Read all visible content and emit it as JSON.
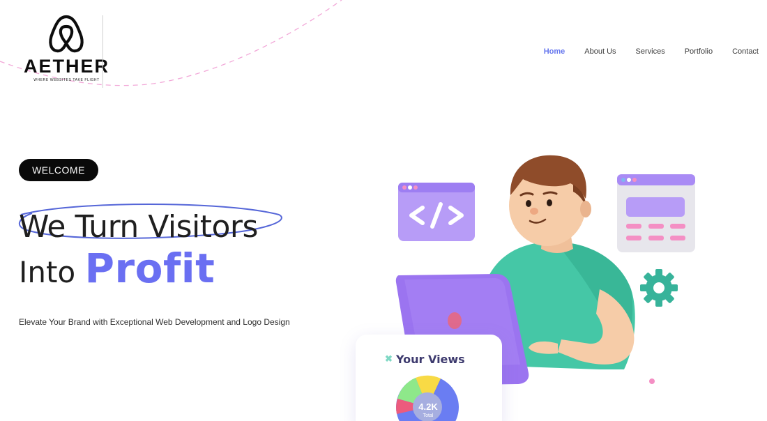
{
  "brand": {
    "name": "AETHER",
    "tagline": "WHERE WEBSITES TAKE FLIGHT"
  },
  "nav": {
    "items": [
      {
        "label": "Home",
        "active": true
      },
      {
        "label": "About Us",
        "active": false
      },
      {
        "label": "Services",
        "active": false
      },
      {
        "label": "Portfolio",
        "active": false
      },
      {
        "label": "Contact",
        "active": false
      }
    ]
  },
  "hero": {
    "badge": "WELCOME",
    "headline_line1": "We Turn Visitors",
    "headline_line2_prefix": "Into",
    "headline_highlight": "Profit",
    "subtitle": "Elevate Your Brand with Exceptional Web Development and Logo Design"
  },
  "views_card": {
    "title": "Your Views",
    "value": "4.2K",
    "label": "Total"
  },
  "colors": {
    "accent": "#6a6ff2",
    "nav_active": "#6677ee",
    "badge_bg": "#0a0a0a",
    "illustration_purple": "#a98bf5",
    "shirt_teal": "#3fbf9f"
  },
  "icons": {
    "logo": "airbnb-style-loop-logo",
    "code_window": "code-brackets-icon",
    "settings": "gear-icon",
    "views": "x-sparkle-icon"
  }
}
